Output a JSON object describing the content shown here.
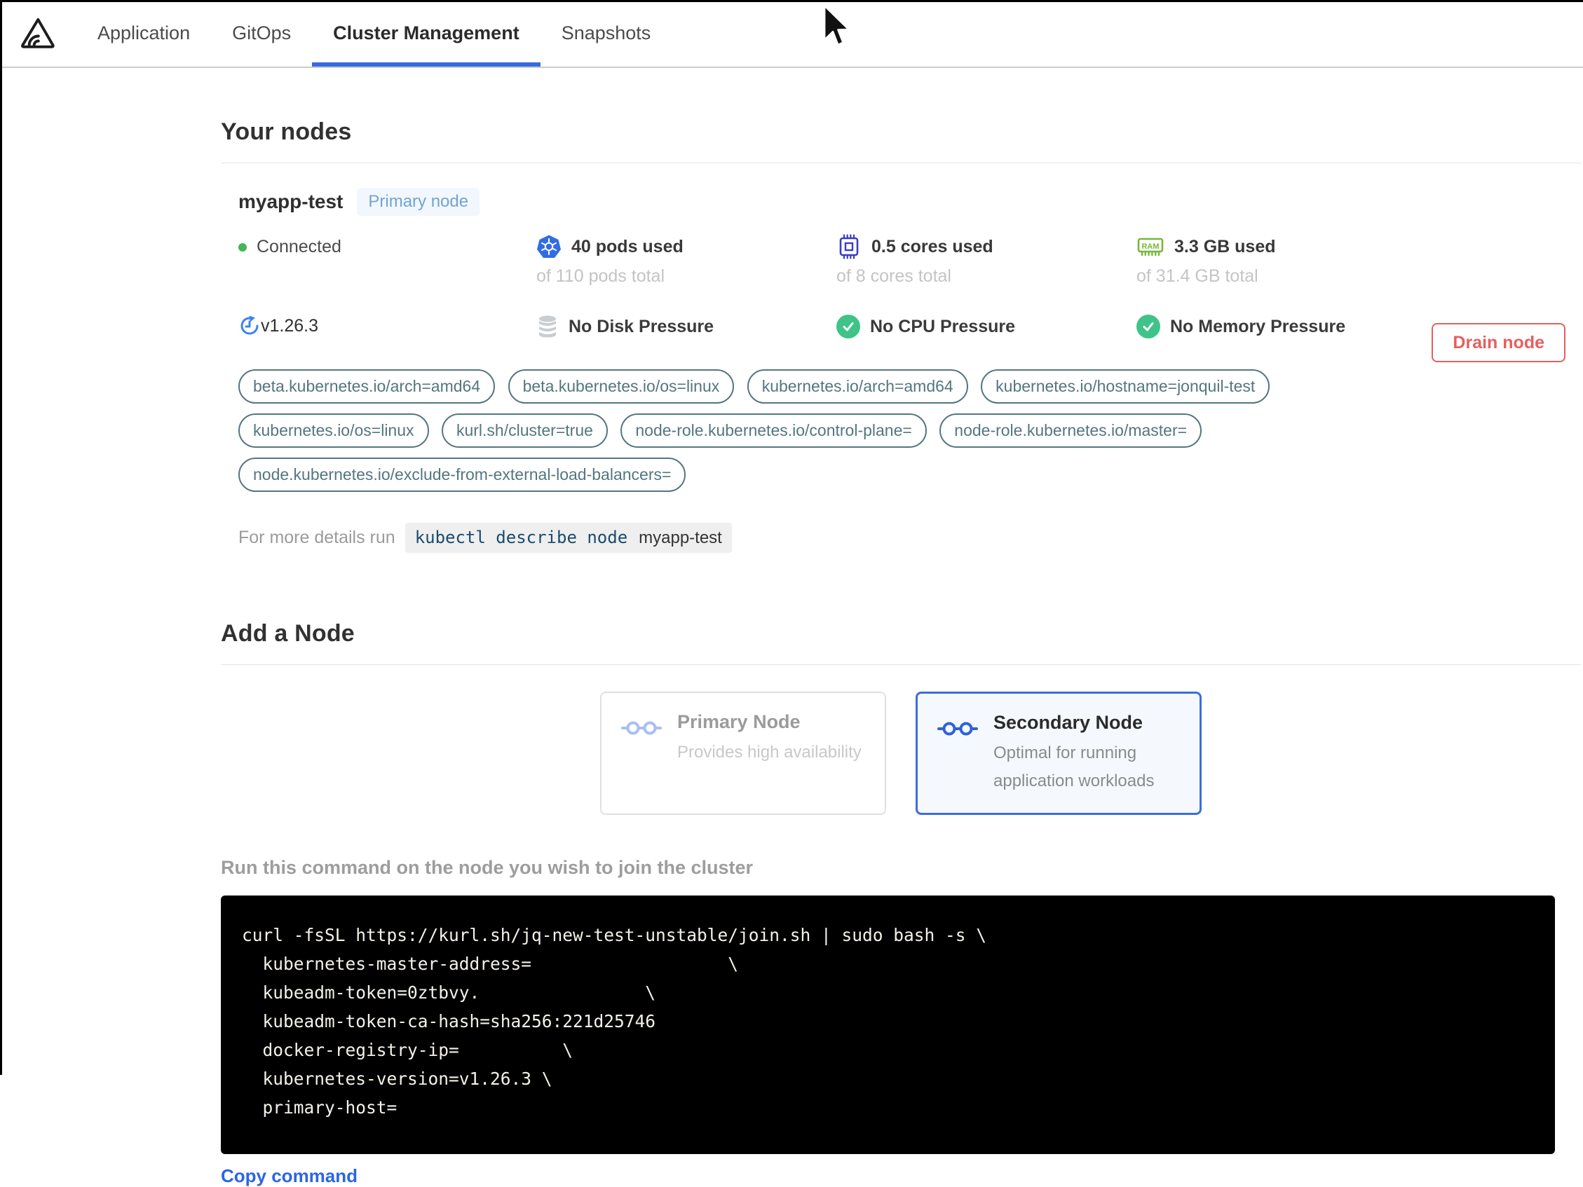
{
  "nav": {
    "tabs": [
      {
        "label": "Application",
        "active": false
      },
      {
        "label": "GitOps",
        "active": false
      },
      {
        "label": "Cluster Management",
        "active": true
      },
      {
        "label": "Snapshots",
        "active": false
      }
    ]
  },
  "your_nodes": {
    "title": "Your nodes",
    "node": {
      "name": "myapp-test",
      "badge": "Primary node",
      "status": "Connected",
      "version": "v1.26.3",
      "stats": [
        {
          "icon": "kubernetes-icon",
          "value": "40 pods used",
          "total": "of 110 pods total"
        },
        {
          "icon": "cpu-icon",
          "value": "0.5 cores used",
          "total": "of 8 cores total"
        },
        {
          "icon": "ram-icon",
          "value": "3.3 GB used",
          "total": "of 31.4 GB total"
        }
      ],
      "conditions": [
        {
          "icon": "disk-icon",
          "label": "No Disk Pressure"
        },
        {
          "icon": "check-icon",
          "label": "No CPU Pressure"
        },
        {
          "icon": "check-icon",
          "label": "No Memory Pressure"
        }
      ],
      "labels": [
        "beta.kubernetes.io/arch=amd64",
        "beta.kubernetes.io/os=linux",
        "kubernetes.io/arch=amd64",
        "kubernetes.io/hostname=jonquil-test",
        "kubernetes.io/os=linux",
        "kurl.sh/cluster=true",
        "node-role.kubernetes.io/control-plane=",
        "node-role.kubernetes.io/master=",
        "node.kubernetes.io/exclude-from-external-load-balancers="
      ],
      "details_hint": "For more details run",
      "details_command": "kubectl describe node",
      "details_command_suffix": "myapp-test",
      "drain_button": "Drain node"
    }
  },
  "add_node": {
    "title": "Add a Node",
    "options": [
      {
        "title": "Primary Node",
        "description": "Provides high availability",
        "selected": false
      },
      {
        "title": "Secondary Node",
        "description": "Optimal for running application workloads",
        "selected": true
      }
    ],
    "instruction": "Run this command on the node you wish to join the cluster",
    "command": "curl -fsSL https://kurl.sh/jq-new-test-unstable/join.sh | sudo bash -s \\\n  kubernetes-master-address=                   \\\n  kubeadm-token=0ztbvy.                \\\n  kubeadm-token-ca-hash=sha256:221d25746\n  docker-registry-ip=          \\\n  kubernetes-version=v1.26.3 \\\n  primary-host=",
    "copy_label": "Copy command"
  },
  "colors": {
    "accent_blue": "#366ae0",
    "link_blue": "#2a66e5",
    "success_green": "#3fc389",
    "danger_red": "#e4605f",
    "pill_teal": "#53767f",
    "kubernetes_blue": "#326ce5",
    "cpu_indigo": "#3d3bc4",
    "ram_green": "#76b83a",
    "badge_blue": "#73a3d2"
  }
}
